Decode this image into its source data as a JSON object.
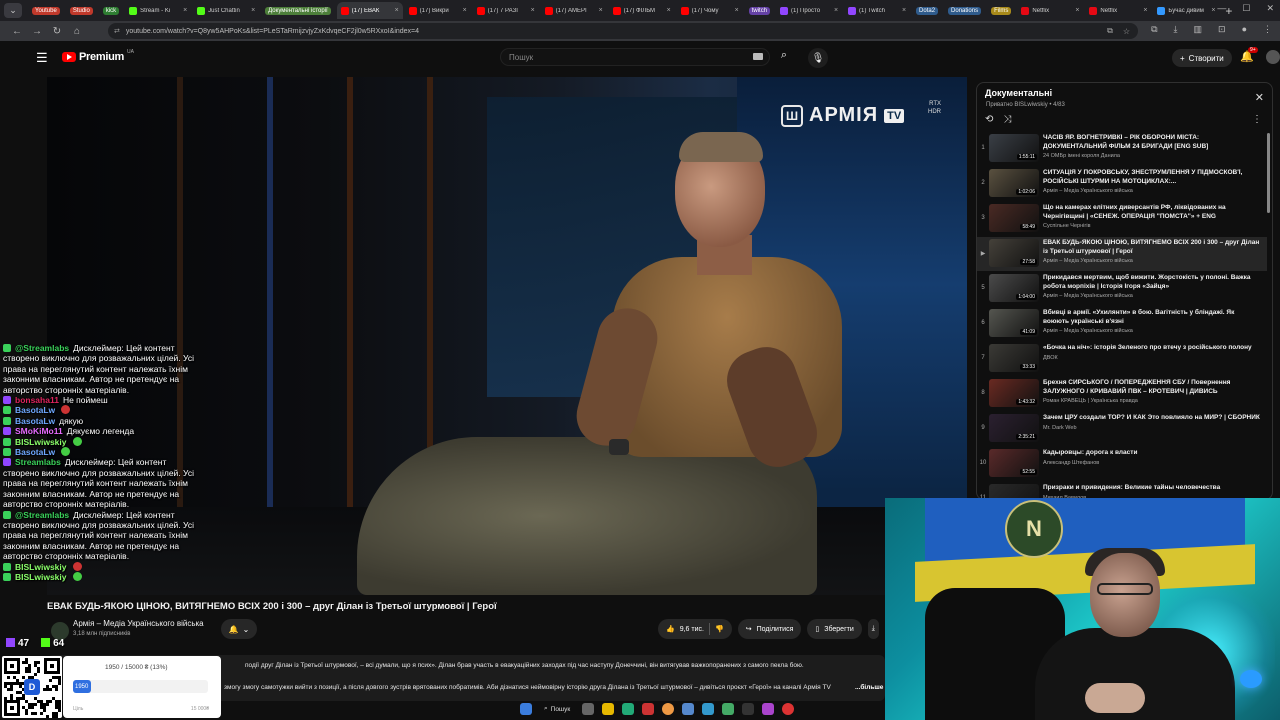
{
  "browser": {
    "tabs": [
      {
        "label": "Youtube",
        "chip": true,
        "color": "#c0392b",
        "fav": "#e44"
      },
      {
        "label": "Studio",
        "chip": true,
        "color": "#c0392b",
        "fav": "#e44"
      },
      {
        "label": "kick",
        "chip": true,
        "color": "#2e7d32",
        "fav": "#53fc18"
      },
      {
        "label": "Stream - Ki",
        "chip": false,
        "fav": "#53fc18"
      },
      {
        "label": "Just Chattin",
        "chip": false,
        "fav": "#53fc18"
      },
      {
        "label": "Документальні історії",
        "chip": true,
        "color": "#4d7f3a",
        "fav": "#6c6"
      },
      {
        "label": "(17) ЕВАК",
        "chip": false,
        "fav": "#f00",
        "active": true
      },
      {
        "label": "(17) Викри",
        "chip": false,
        "fav": "#f00"
      },
      {
        "label": "(17) 7 РАЗІ",
        "chip": false,
        "fav": "#f00"
      },
      {
        "label": "(17) АМЕРІ",
        "chip": false,
        "fav": "#f00"
      },
      {
        "label": "(17) ФІЛЬМ",
        "chip": false,
        "fav": "#f00"
      },
      {
        "label": "(17) Чому",
        "chip": false,
        "fav": "#f00"
      },
      {
        "label": "twitch",
        "chip": true,
        "color": "#6441a5",
        "fav": "#9146ff"
      },
      {
        "label": "(1) Просто",
        "chip": false,
        "fav": "#9146ff"
      },
      {
        "label": "(1) Twitch",
        "chip": false,
        "fav": "#9146ff"
      },
      {
        "label": "Dota2",
        "chip": true,
        "color": "#2f5b8c",
        "fav": "#b33"
      },
      {
        "label": "Donations",
        "chip": true,
        "color": "#2f5b8c",
        "fav": "#39f"
      },
      {
        "label": "Films",
        "chip": true,
        "color": "#a88a1a",
        "fav": "#fc0"
      },
      {
        "label": "Netflix",
        "chip": false,
        "fav": "#e50914"
      },
      {
        "label": "Netflix",
        "chip": false,
        "fav": "#e50914"
      },
      {
        "label": "Бучас дивим",
        "chip": false,
        "fav": "#39f"
      }
    ],
    "url": "youtube.com/watch?v=Q8yw5AHPoKs&list=PLeSTaRmijzvjyZxKdvqeCF2jl0w5RXxoI&index=4"
  },
  "youtube": {
    "logo_text": "Premium",
    "logo_region": "UA",
    "search_placeholder": "Пошук",
    "create_label": "Створити",
    "notif_count": "9+"
  },
  "video": {
    "title": "ЕВАК БУДЬ-ЯКОЮ ЦІНОЮ, ВИТЯГНЕМО ВСІХ 200 і 300 – друг Ділан із Третьої штурмової | Герої",
    "channel_logo_text": "АРМІЯ",
    "channel_logo_tv": "TV",
    "rtx_line1": "RTX",
    "rtx_line2": "HDR",
    "channel_name": "Армія – Медіа Українського війська",
    "subscribers": "3,18 млн підписників",
    "likes": "9,6 тис.",
    "share_label": "Поділитися",
    "save_label": "Зберегти",
    "description_line1": "події друг Ділан із Третьої штурмової, – всі думали, що я псих». Ділан брав участь в евакуаційних заходах під час наступу Донеччині, він витягував важкопоранених з самого пекла бою.",
    "description_line2": "змогу змогу самотужки вийти з позиції, а після довгого зустрів врятованих побратимів. Аби дізнатися неймовірну історію друга Ділана із Третьої штурмової – дивіться проєкт «Герої» на каналі Армія TV",
    "description_more": "...більше"
  },
  "playlist": {
    "title": "Документальні",
    "meta": "Приватно  BISLwiwskiy  •  4/83",
    "items": [
      {
        "idx": "1",
        "title": "ЧАСІВ ЯР. ВОГНЕТРИВКІ – РІК ОБОРОНИ МІСТА: ДОКУМЕНТАЛЬНИЙ ФІЛЬМ 24 БРИГАДИ [ENG SUB]",
        "channel": "24 ОМБр імені короля Данила",
        "duration": "1:55:11",
        "thumb": "#3a3f46"
      },
      {
        "idx": "2",
        "title": "СИТУАЦІЯ У ПОКРОВСЬКУ, ЗНЕСТРУМЛЕННЯ У ПІДМОСКОВ'Ї, РОСІЙСЬКІ ШТУРМИ НА МОТОЦИКЛАХ:...",
        "channel": "Армія – Медіа Українського війська",
        "duration": "1:02:06",
        "thumb": "#5a5140"
      },
      {
        "idx": "3",
        "title": "Що на камерах елітних диверсантів РФ, ліквідованих на Чернігівщині | «СЕНЕЖ. ОПЕРАЦІЯ \"ПОМСТА\"» + ENG",
        "channel": "Суспільне Чернігів",
        "duration": "58:49",
        "thumb": "#4a2a24"
      },
      {
        "idx": "▶",
        "title": "ЕВАК БУДЬ-ЯКОЮ ЦІНОЮ, ВИТЯГНЕМО ВСІХ 200 і 300 – друг Ділан із Третьої штурмової | Герої",
        "channel": "Армія – Медіа Українського війська",
        "duration": "27:58",
        "thumb": "#45413a",
        "active": true
      },
      {
        "idx": "5",
        "title": "Прикидався мертвим, щоб вижити. Жорстокість у полоні. Важка робота морпіхів | Історія Ігоря «Зайця»",
        "channel": "Армія – Медіа Українського війська",
        "duration": "1:04:00",
        "thumb": "#4b4b4b"
      },
      {
        "idx": "6",
        "title": "Вбивці в армії. «Ухилянти» в бою. Вагітність у бліндажі. Як воюють українські в'язні",
        "channel": "Армія – Медіа Українського війська",
        "duration": "41:09",
        "thumb": "#555650"
      },
      {
        "idx": "7",
        "title": "«Бочка на ніч»: історія Зеленого про втечу з російського полону",
        "channel": "ДВОК",
        "duration": "33:33",
        "thumb": "#3b3a36"
      },
      {
        "idx": "8",
        "title": "Брехня СИРСЬКОГО / ПОПЕРЕДЖЕННЯ СБУ / Повернення ЗАЛУЖНОГО / КРИВАВИЙ ПВК – КРОТЕВИЧ | ДИВИСЬ",
        "channel": "Роман КРАВЕЦЬ | Українська правда",
        "duration": "1:43:32",
        "thumb": "#6a2a22"
      },
      {
        "idx": "9",
        "title": "Зачем ЦРУ создали ТОР? И КАК Это повлияло на МИР? | СБОРНИК",
        "channel": "Mr. Dark Web",
        "duration": "2:35:21",
        "thumb": "#2b2030"
      },
      {
        "idx": "10",
        "title": "Кадыровцы: дорога к власти",
        "channel": "Александр Штефанов",
        "duration": "52:55",
        "thumb": "#5a2a2a"
      },
      {
        "idx": "11",
        "title": "Призраки и привидения: Великие тайны человечества",
        "channel": "Михаил Вавилов",
        "duration": "",
        "thumb": "#2a2a2a"
      }
    ]
  },
  "chat": [
    {
      "user": "@Streamlabs",
      "color": "#3ad15a",
      "badge": "#3ad15a",
      "text": "Дисклеймер: Цей контент",
      "cont": [
        "створено виключно для розважальних цілей. Усі",
        "права на переглянутий контент належать їхнім",
        "законним власникам. Автор не претендує на",
        "авторство сторонніх матеріалів."
      ]
    },
    {
      "user": "bonsaha11",
      "color": "#e0245e",
      "badge": "#9146ff",
      "text": "Не поймеш",
      "cont": []
    },
    {
      "user": "BasotaLw",
      "color": "#6fa8ff",
      "badge": "#3ad15a",
      "text": "",
      "emote": "#c33",
      "cont": []
    },
    {
      "user": "BasotaLw",
      "color": "#6fa8ff",
      "badge": "#3ad15a",
      "text": "дякую",
      "cont": []
    },
    {
      "user": "SMoKiMo11",
      "color": "#e76bff",
      "badge": "#9146ff",
      "text": "Дякуємо легенда",
      "cont": []
    },
    {
      "user": "BISLwiwskiy",
      "color": "#8cff6b",
      "badge": "#3ad15a",
      "text": "",
      "emote": "#4c4",
      "cont": []
    },
    {
      "user": "BasotaLw",
      "color": "#6fa8ff",
      "badge": "#3ad15a",
      "text": "",
      "emote": "#4c4",
      "cont": []
    },
    {
      "user": "Streamlabs",
      "color": "#3ad15a",
      "badge": "#9146ff",
      "text": "Дисклеймер: Цей контент",
      "cont": [
        "створено виключно для розважальних цілей. Усі",
        "права на переглянутий контент належать їхнім",
        "законним власникам. Автор не претендує на",
        "авторство сторонніх матеріалів."
      ]
    },
    {
      "user": "@Streamlabs",
      "color": "#3ad15a",
      "badge": "#3ad15a",
      "text": "Дисклеймер: Цей контент",
      "cont": [
        "створено виключно для розважальних цілей. Усі",
        "права на переглянутий контент належать їхнім",
        "законним власникам. Автор не претендує на",
        "авторство сторонніх матеріалів."
      ]
    },
    {
      "user": "BISLwiwskiy",
      "color": "#8cff6b",
      "badge": "#3ad15a",
      "text": "",
      "emote": "#c33",
      "cont": []
    },
    {
      "user": "BISLwiwskiy",
      "color": "#8cff6b",
      "badge": "#3ad15a",
      "text": "",
      "emote": "#4c4",
      "cont": []
    }
  ],
  "stats": {
    "viewers_a": "47",
    "viewers_b": "64"
  },
  "donation": {
    "amount": "1950 / 15000 ₴ (13%)",
    "progress": 0.13,
    "fill_text": "1950",
    "left_label": "Ціль",
    "right_label": "15 000₴"
  },
  "taskbar": {
    "search_label": "Пошук"
  }
}
